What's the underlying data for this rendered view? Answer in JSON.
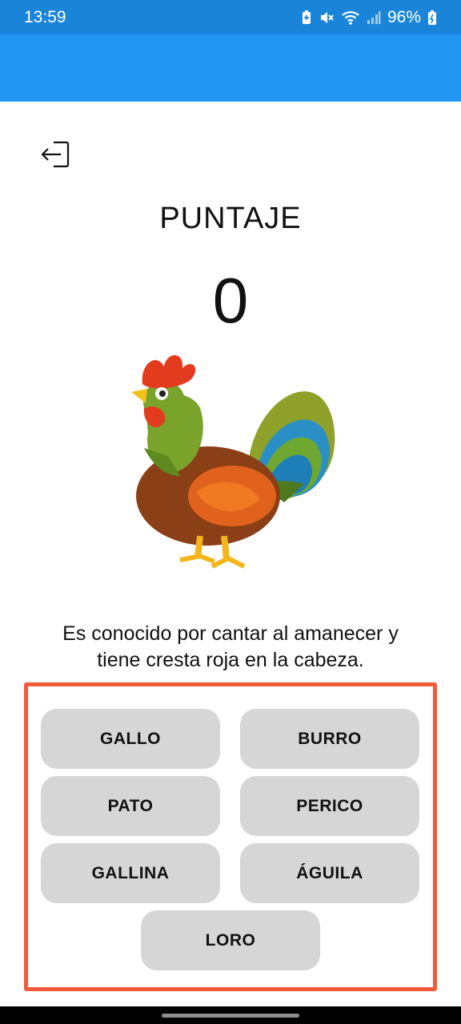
{
  "status_bar": {
    "time": "13:59",
    "battery_percent": "96%",
    "icons": [
      "battery-saver-icon",
      "mute-icon",
      "wifi-icon",
      "signal-icon",
      "battery-charging-icon"
    ]
  },
  "header": {
    "exit_icon": "exit-icon"
  },
  "score": {
    "title": "PUNTAJE",
    "value": "0"
  },
  "animal": {
    "image_icon": "rooster-illustration"
  },
  "clue": {
    "line1": "Es conocido por cantar al amanecer y",
    "line2": "tiene cresta roja en la cabeza."
  },
  "options": [
    "GALLO",
    "BURRO",
    "PATO",
    "PERICO",
    "GALLINA",
    "ÁGUILA",
    "LORO"
  ],
  "colors": {
    "status_bar": "#1a85d8",
    "app_bar": "#2196f3",
    "option_bg": "#d6d6d6",
    "highlight_border": "#f25a3c"
  }
}
